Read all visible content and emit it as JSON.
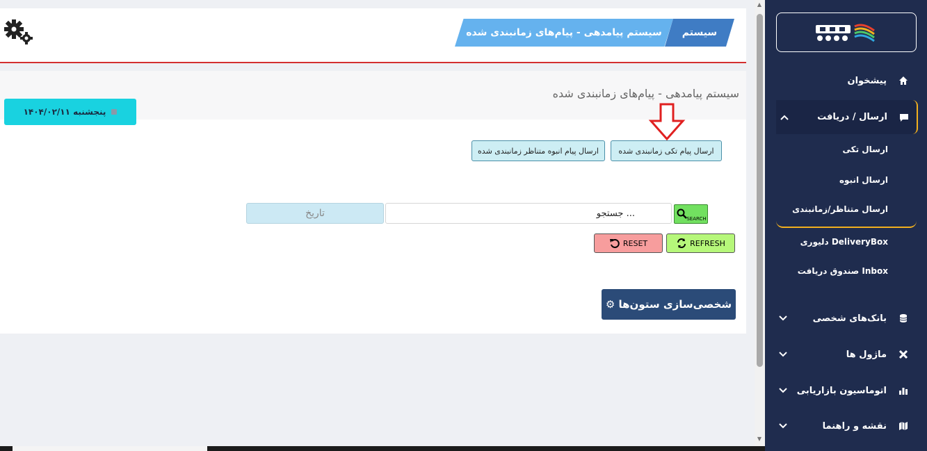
{
  "header": {
    "breadcrumb_system": "سیستم",
    "breadcrumb_page": "سیستم پیامدهی - پیام‌های زمانبندی شده"
  },
  "main": {
    "title": "سیستم پیامدهی - پیام‌های زمانبندی شده",
    "date_label": "پنجشنبه ۱۴۰۴/۰۲/۱۱",
    "actions": {
      "single": "ارسال پیام تکی زمانبندی شده",
      "bulk": "ارسال پیام انبوه متناظر زمانبندی شده"
    },
    "search": {
      "placeholder": "جستجو ...",
      "button": "SEARCH"
    },
    "date_filter": {
      "placeholder": "تاریخ"
    },
    "refresh": "REFRESH",
    "reset": "RESET",
    "customize_columns": "⚙ شخصی‌سازی ستون‌ها"
  },
  "sidebar": {
    "items": [
      {
        "label": "پیشخوان",
        "icon": "home-icon"
      },
      {
        "label": "ارسال / دریافت",
        "icon": "message-icon",
        "expanded": true
      },
      {
        "label": "بانک‌های شخصی",
        "icon": "database-icon"
      },
      {
        "label": "ماژول ها",
        "icon": "tools-icon"
      },
      {
        "label": "اتوماسیون بازاریابی",
        "icon": "chart-icon"
      },
      {
        "label": "نقشه و راهنما",
        "icon": "map-icon"
      }
    ],
    "subitems": [
      {
        "label": "ارسال تکی"
      },
      {
        "label": "ارسال انبوه"
      },
      {
        "label": "ارسال متناظر/زمانبندی"
      },
      {
        "label": "دلیوری DeliveryBox"
      },
      {
        "label": "صندوق دریافت Inbox"
      }
    ]
  },
  "colors": {
    "sidebar_bg": "#1f2c4e",
    "accent": "#f2b01e",
    "header_divider": "#d32f2f"
  }
}
